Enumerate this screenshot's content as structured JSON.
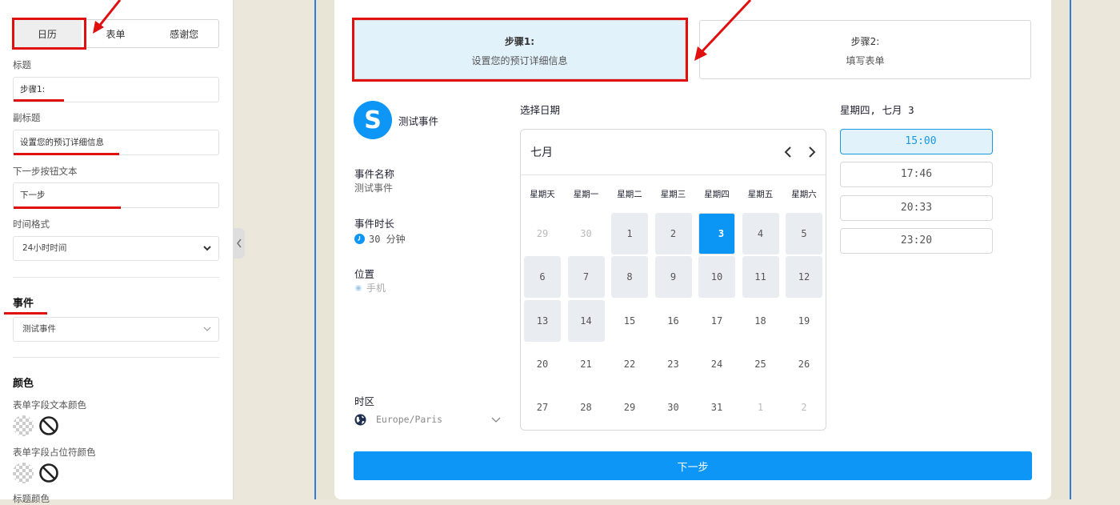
{
  "settings": {
    "tabs": [
      "日历",
      "表单",
      "感谢您"
    ],
    "title_label": "标题",
    "title_value": "步骤1:",
    "subtitle_label": "副标题",
    "subtitle_value": "设置您的预订详细信息",
    "next_label": "下一步按钮文本",
    "next_value": "下一步",
    "time_format_label": "时间格式",
    "time_format_value": "24小时时间",
    "event_section": "事件",
    "event_value": "测试事件",
    "color_section": "颜色",
    "field_text_color": "表单字段文本颜色",
    "placeholder_color": "表单字段占位符颜色",
    "title_color": "标题颜色"
  },
  "preview": {
    "steps": [
      {
        "title": "步骤1:",
        "subtitle": "设置您的预订详细信息"
      },
      {
        "title": "步骤2:",
        "subtitle": "填写表单"
      }
    ],
    "event": {
      "logo_letter": "S",
      "title": "测试事件",
      "name_label": "事件名称",
      "name_value": "测试事件",
      "duration_label": "事件时长",
      "duration_value": "30 分钟",
      "location_label": "位置",
      "location_value": "手机",
      "timezone_label": "时区",
      "timezone_value": "Europe/Paris"
    },
    "calendar": {
      "heading": "选择日期",
      "month": "七月",
      "weekdays": [
        "星期天",
        "星期一",
        "星期二",
        "星期三",
        "星期四",
        "星期五",
        "星期六"
      ],
      "days": [
        [
          "29",
          "30",
          "1",
          "2",
          "3",
          "4",
          "5"
        ],
        [
          "6",
          "7",
          "8",
          "9",
          "10",
          "11",
          "12"
        ],
        [
          "13",
          "14",
          "15",
          "16",
          "17",
          "18",
          "19"
        ],
        [
          "20",
          "21",
          "22",
          "23",
          "24",
          "25",
          "26"
        ],
        [
          "27",
          "28",
          "29",
          "30",
          "31",
          "1",
          "2"
        ]
      ]
    },
    "times": {
      "heading": "星期四, 七月 3",
      "slots": [
        "15:00",
        "17:46",
        "20:33",
        "23:20"
      ]
    },
    "next_button": "下一步"
  },
  "colors": {
    "accent": "#0d96f5",
    "annotation_red": "#e01010",
    "selected_bg": "#e2f2fb"
  }
}
